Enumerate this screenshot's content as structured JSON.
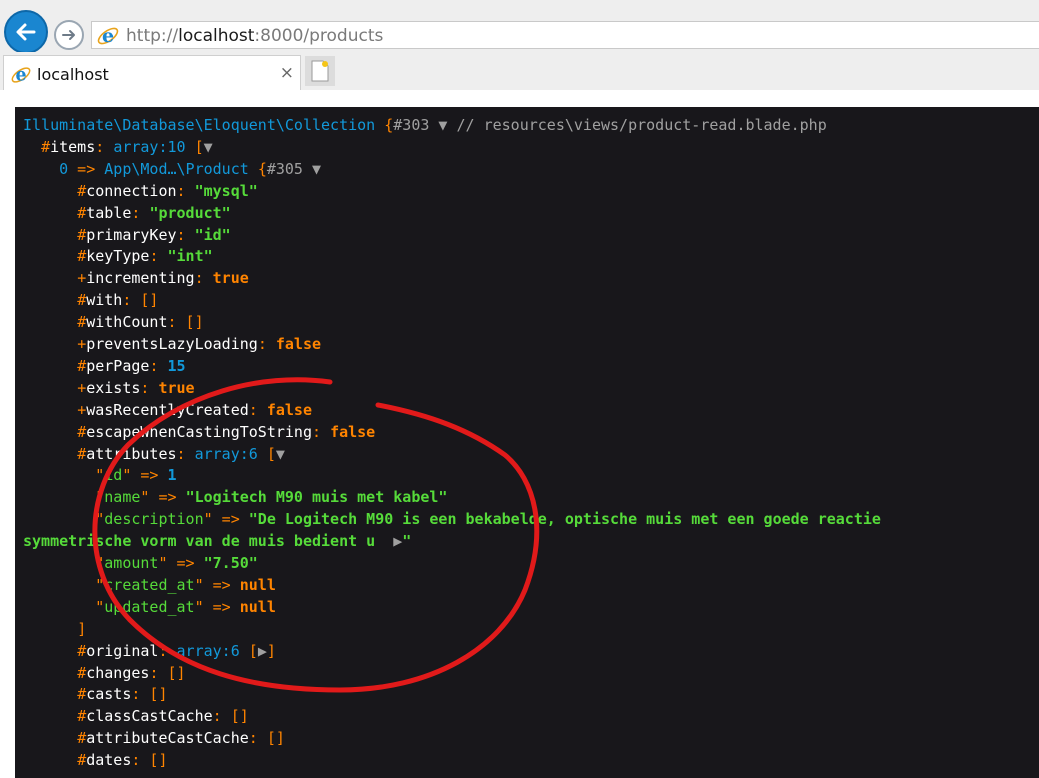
{
  "browser": {
    "url_prefix": "http://",
    "url_host": "localhost",
    "url_rest": ":8000/products",
    "tab_title": "localhost",
    "tab_close": "×"
  },
  "dump": {
    "lines": [
      [
        {
          "c": "cls",
          "t": "Illuminate\\Database\\Eloquent\\Collection"
        },
        {
          "c": "pun",
          "t": " "
        },
        {
          "c": "op",
          "t": "{"
        },
        {
          "c": "ann",
          "t": "#303 "
        },
        {
          "c": "tri",
          "t": "▼"
        },
        {
          "c": "ann",
          "t": " // resources\\views/product-read.blade.php"
        }
      ],
      [
        {
          "c": "pun",
          "t": "  "
        },
        {
          "c": "op",
          "t": "#"
        },
        {
          "c": "prop",
          "t": "items"
        },
        {
          "c": "op",
          "t": ": "
        },
        {
          "c": "cls",
          "t": "array:10"
        },
        {
          "c": "op",
          "t": " ["
        },
        {
          "c": "tri",
          "t": "▼"
        }
      ],
      [
        {
          "c": "pun",
          "t": "    "
        },
        {
          "c": "cls",
          "t": "0"
        },
        {
          "c": "op",
          "t": " => "
        },
        {
          "c": "cls",
          "t": "App\\Mod…\\Product"
        },
        {
          "c": "pun",
          "t": " "
        },
        {
          "c": "op",
          "t": "{"
        },
        {
          "c": "ann",
          "t": "#305 "
        },
        {
          "c": "tri",
          "t": "▼"
        }
      ],
      [
        {
          "c": "pun",
          "t": "      "
        },
        {
          "c": "op",
          "t": "#"
        },
        {
          "c": "prop",
          "t": "connection"
        },
        {
          "c": "op",
          "t": ": "
        },
        {
          "c": "str",
          "t": "\"mysql\""
        }
      ],
      [
        {
          "c": "pun",
          "t": "      "
        },
        {
          "c": "op",
          "t": "#"
        },
        {
          "c": "prop",
          "t": "table"
        },
        {
          "c": "op",
          "t": ": "
        },
        {
          "c": "str",
          "t": "\"product\""
        }
      ],
      [
        {
          "c": "pun",
          "t": "      "
        },
        {
          "c": "op",
          "t": "#"
        },
        {
          "c": "prop",
          "t": "primaryKey"
        },
        {
          "c": "op",
          "t": ": "
        },
        {
          "c": "str",
          "t": "\"id\""
        }
      ],
      [
        {
          "c": "pun",
          "t": "      "
        },
        {
          "c": "op",
          "t": "#"
        },
        {
          "c": "prop",
          "t": "keyType"
        },
        {
          "c": "op",
          "t": ": "
        },
        {
          "c": "str",
          "t": "\"int\""
        }
      ],
      [
        {
          "c": "pun",
          "t": "      "
        },
        {
          "c": "op",
          "t": "+"
        },
        {
          "c": "prop",
          "t": "incrementing"
        },
        {
          "c": "op",
          "t": ": "
        },
        {
          "c": "const",
          "t": "true"
        }
      ],
      [
        {
          "c": "pun",
          "t": "      "
        },
        {
          "c": "op",
          "t": "#"
        },
        {
          "c": "prop",
          "t": "with"
        },
        {
          "c": "op",
          "t": ": []"
        }
      ],
      [
        {
          "c": "pun",
          "t": "      "
        },
        {
          "c": "op",
          "t": "#"
        },
        {
          "c": "prop",
          "t": "withCount"
        },
        {
          "c": "op",
          "t": ": []"
        }
      ],
      [
        {
          "c": "pun",
          "t": "      "
        },
        {
          "c": "op",
          "t": "+"
        },
        {
          "c": "prop",
          "t": "preventsLazyLoading"
        },
        {
          "c": "op",
          "t": ": "
        },
        {
          "c": "const",
          "t": "false"
        }
      ],
      [
        {
          "c": "pun",
          "t": "      "
        },
        {
          "c": "op",
          "t": "#"
        },
        {
          "c": "prop",
          "t": "perPage"
        },
        {
          "c": "op",
          "t": ": "
        },
        {
          "c": "num",
          "t": "15"
        }
      ],
      [
        {
          "c": "pun",
          "t": "      "
        },
        {
          "c": "op",
          "t": "+"
        },
        {
          "c": "prop",
          "t": "exists"
        },
        {
          "c": "op",
          "t": ": "
        },
        {
          "c": "const",
          "t": "true"
        }
      ],
      [
        {
          "c": "pun",
          "t": "      "
        },
        {
          "c": "op",
          "t": "+"
        },
        {
          "c": "prop",
          "t": "wasRecentlyCreated"
        },
        {
          "c": "op",
          "t": ": "
        },
        {
          "c": "const",
          "t": "false"
        }
      ],
      [
        {
          "c": "pun",
          "t": "      "
        },
        {
          "c": "op",
          "t": "#"
        },
        {
          "c": "prop",
          "t": "escapeWhenCastingToString"
        },
        {
          "c": "op",
          "t": ": "
        },
        {
          "c": "const",
          "t": "false"
        }
      ],
      [
        {
          "c": "pun",
          "t": "      "
        },
        {
          "c": "op",
          "t": "#"
        },
        {
          "c": "prop",
          "t": "attributes"
        },
        {
          "c": "op",
          "t": ": "
        },
        {
          "c": "cls",
          "t": "array:6"
        },
        {
          "c": "op",
          "t": " ["
        },
        {
          "c": "tri",
          "t": "▼"
        }
      ],
      [
        {
          "c": "pun",
          "t": "        "
        },
        {
          "c": "op",
          "t": "\""
        },
        {
          "c": "key",
          "t": "id"
        },
        {
          "c": "op",
          "t": "\" => "
        },
        {
          "c": "num",
          "t": "1"
        }
      ],
      [
        {
          "c": "pun",
          "t": "        "
        },
        {
          "c": "op",
          "t": "\""
        },
        {
          "c": "key",
          "t": "name"
        },
        {
          "c": "op",
          "t": "\" => "
        },
        {
          "c": "str",
          "t": "\"Logitech M90 muis met kabel\""
        }
      ],
      [
        {
          "c": "pun",
          "t": "        "
        },
        {
          "c": "op",
          "t": "\""
        },
        {
          "c": "key",
          "t": "description"
        },
        {
          "c": "op",
          "t": "\" => "
        },
        {
          "c": "str",
          "t": "\"De Logitech M90 is een bekabelde, optische muis met een goede reactie"
        }
      ],
      [
        {
          "c": "str",
          "t": "symmetrische vorm van de muis bedient u  "
        },
        {
          "c": "tri",
          "t": "▶"
        },
        {
          "c": "str",
          "t": "\""
        }
      ],
      [
        {
          "c": "pun",
          "t": "        "
        },
        {
          "c": "op",
          "t": "\""
        },
        {
          "c": "key",
          "t": "amount"
        },
        {
          "c": "op",
          "t": "\" => "
        },
        {
          "c": "str",
          "t": "\"7.50\""
        }
      ],
      [
        {
          "c": "pun",
          "t": "        "
        },
        {
          "c": "op",
          "t": "\""
        },
        {
          "c": "key",
          "t": "created_at"
        },
        {
          "c": "op",
          "t": "\" => "
        },
        {
          "c": "const",
          "t": "null"
        }
      ],
      [
        {
          "c": "pun",
          "t": "        "
        },
        {
          "c": "op",
          "t": "\""
        },
        {
          "c": "key",
          "t": "updated_at"
        },
        {
          "c": "op",
          "t": "\" => "
        },
        {
          "c": "const",
          "t": "null"
        }
      ],
      [
        {
          "c": "pun",
          "t": "      "
        },
        {
          "c": "op",
          "t": "]"
        }
      ],
      [
        {
          "c": "pun",
          "t": "      "
        },
        {
          "c": "op",
          "t": "#"
        },
        {
          "c": "prop",
          "t": "original"
        },
        {
          "c": "op",
          "t": ": "
        },
        {
          "c": "cls",
          "t": "array:6"
        },
        {
          "c": "op",
          "t": " ["
        },
        {
          "c": "tri",
          "t": "▶"
        },
        {
          "c": "op",
          "t": "]"
        }
      ],
      [
        {
          "c": "pun",
          "t": "      "
        },
        {
          "c": "op",
          "t": "#"
        },
        {
          "c": "prop",
          "t": "changes"
        },
        {
          "c": "op",
          "t": ": []"
        }
      ],
      [
        {
          "c": "pun",
          "t": "      "
        },
        {
          "c": "op",
          "t": "#"
        },
        {
          "c": "prop",
          "t": "casts"
        },
        {
          "c": "op",
          "t": ": []"
        }
      ],
      [
        {
          "c": "pun",
          "t": "      "
        },
        {
          "c": "op",
          "t": "#"
        },
        {
          "c": "prop",
          "t": "classCastCache"
        },
        {
          "c": "op",
          "t": ": []"
        }
      ],
      [
        {
          "c": "pun",
          "t": "      "
        },
        {
          "c": "op",
          "t": "#"
        },
        {
          "c": "prop",
          "t": "attributeCastCache"
        },
        {
          "c": "op",
          "t": ": []"
        }
      ],
      [
        {
          "c": "pun",
          "t": "      "
        },
        {
          "c": "op",
          "t": "#"
        },
        {
          "c": "prop",
          "t": "dates"
        },
        {
          "c": "op",
          "t": ": []"
        }
      ]
    ]
  },
  "colors": {
    "dump_bg": "#18171b",
    "class": "#1299da",
    "operator": "#ff8400",
    "string": "#56db3a",
    "constant": "#ff8400",
    "annotation_circle": "#e11a1a"
  }
}
